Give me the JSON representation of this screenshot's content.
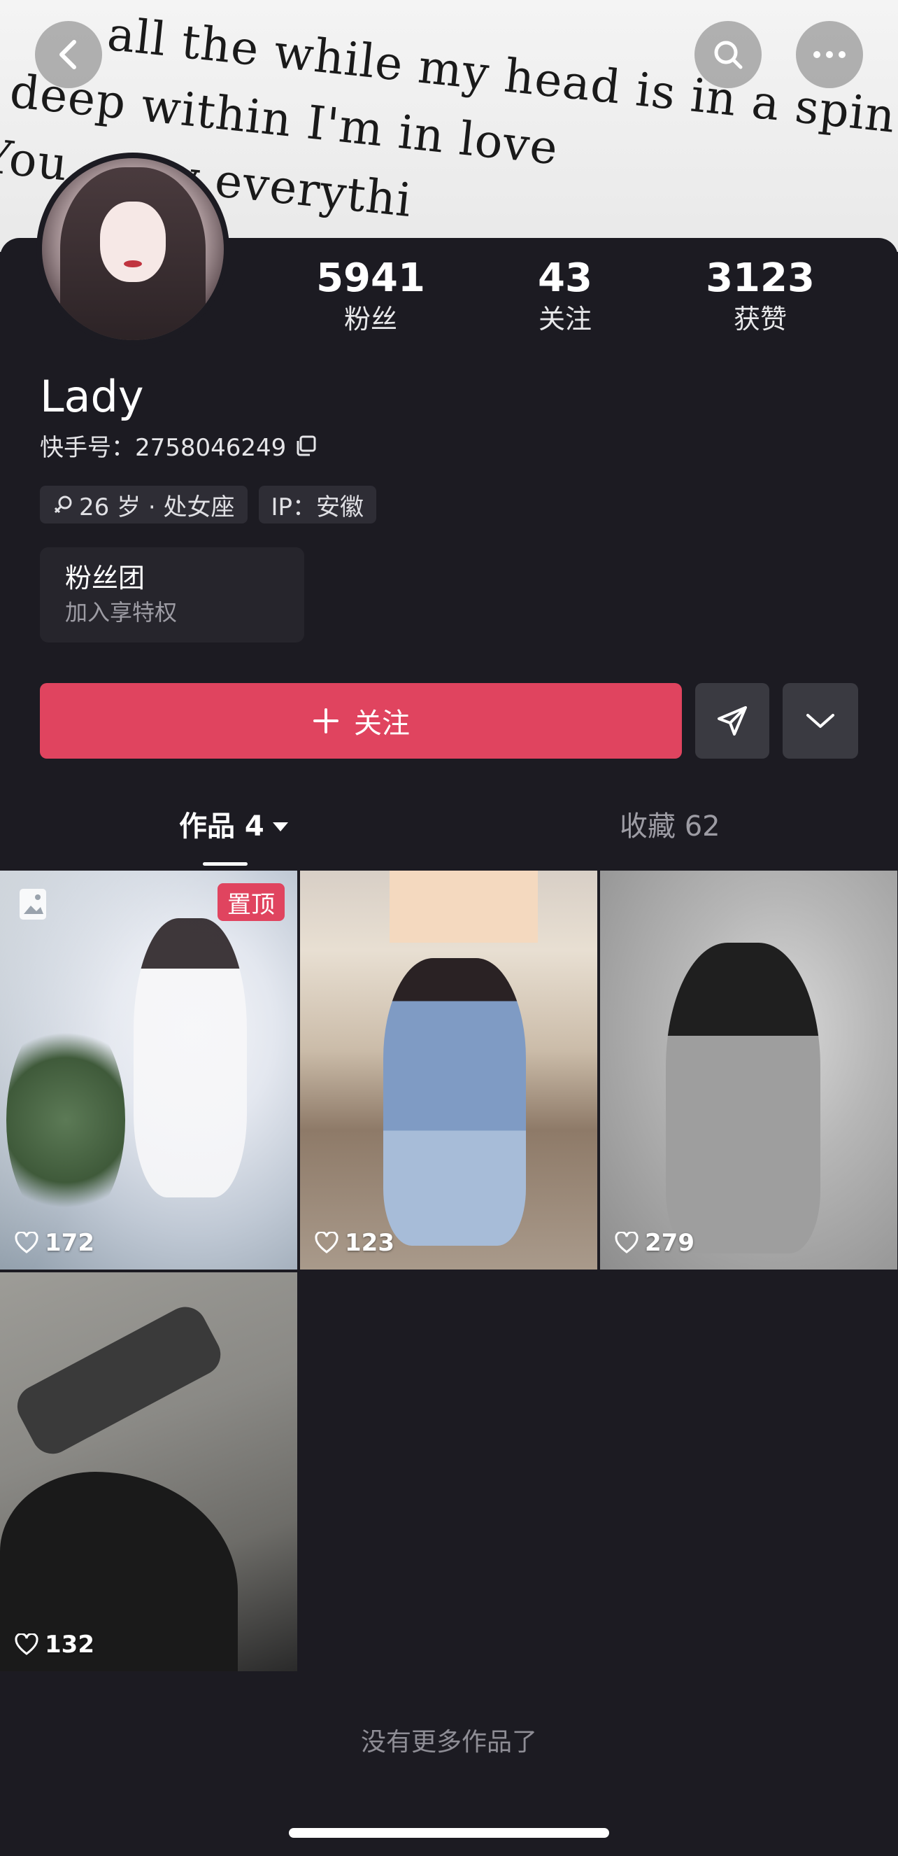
{
  "banner": {
    "lines": [
      "all the while my head is in a spin ... er to my fingertip",
      "deep within I'm in love",
      "You... my everythi",
      ""
    ]
  },
  "profile": {
    "name": "Lady",
    "kuaishou_id_label": "快手号：2758046249",
    "age_sign": "26 岁 · 处女座",
    "ip": "IP：安徽"
  },
  "stats": [
    {
      "value": "5941",
      "label": "粉丝"
    },
    {
      "value": "43",
      "label": "关注"
    },
    {
      "value": "3123",
      "label": "获赞"
    }
  ],
  "fans_club": {
    "title": "粉丝团",
    "subtitle": "加入享特权"
  },
  "actions": {
    "follow_label": "关注"
  },
  "tabs": {
    "works_label": "作品 4",
    "favorites_label": "收藏 62"
  },
  "posts": [
    {
      "likes": "172",
      "badge": "置顶"
    },
    {
      "likes": "123"
    },
    {
      "likes": "279"
    },
    {
      "likes": "132"
    }
  ],
  "footer": {
    "end_text": "没有更多作品了"
  },
  "colors": {
    "background": "#1c1b22",
    "accent": "#e0445f",
    "secondary_button": "#3a3a41"
  }
}
